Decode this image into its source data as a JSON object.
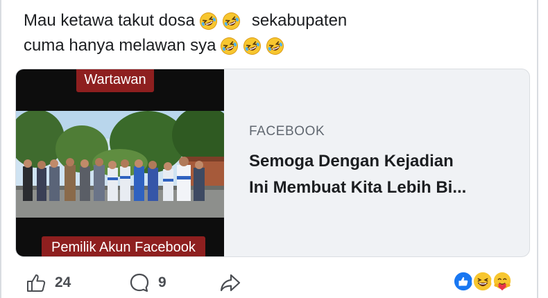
{
  "post": {
    "text_line1": "Mau ketawa takut dosa",
    "text_line1_after": "sekabupaten",
    "text_line2": "cuma hanya melawan sya"
  },
  "link_card": {
    "caption_top": "Wartawan",
    "caption_bottom": "Pemilik Akun Facebook",
    "source": "FACEBOOK",
    "title_line1": "Semoga Dengan Kejadian",
    "title_line2": "Ini Membuat Kita Lebih Bi..."
  },
  "actions": {
    "like_count": "24",
    "comment_count": "9"
  },
  "icons": {
    "like": "thumbs-up-icon",
    "comment": "comment-bubble-icon",
    "share": "share-arrow-icon",
    "laugh_emoji": "rolling-laughing-emoji-icon",
    "reaction_like": "like-reaction-icon",
    "reaction_haha": "haha-reaction-icon",
    "reaction_care": "care-reaction-icon"
  },
  "colors": {
    "caption_bg": "#8e1f1f",
    "card_bg": "#f0f2f5",
    "like_blue": "#1877f2",
    "emoji_yellow": "#f7c62f"
  }
}
